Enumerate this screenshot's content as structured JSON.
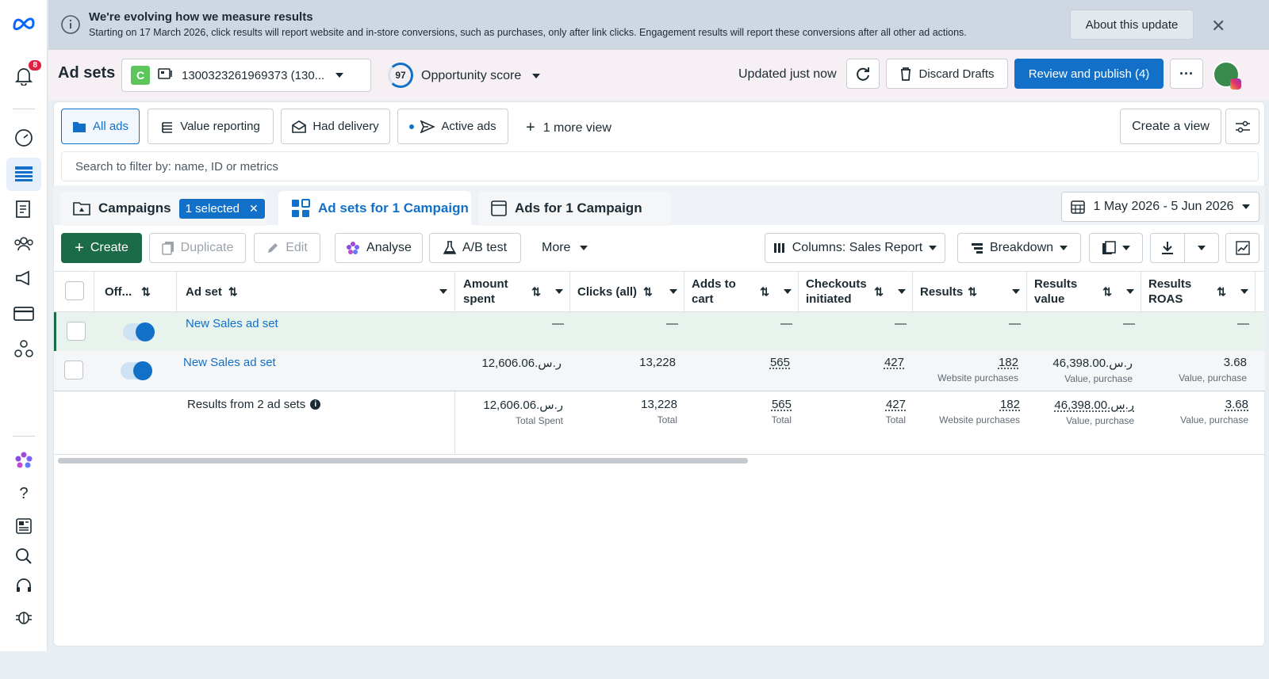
{
  "banner": {
    "title": "We're evolving how we measure results",
    "subtitle": "Starting on 17 March 2026, click results will report website and in-store conversions, such as purchases, only after link clicks. Engagement results will report these conversions after all other ad actions.",
    "about_button": "About this update"
  },
  "rail": {
    "notification_count": "8"
  },
  "header": {
    "page_title": "Ad sets",
    "account_letter": "C",
    "account_name": "1300323261969373 (130...",
    "opportunity_score_value": "97",
    "opportunity_score_label": "Opportunity score",
    "updated_text": "Updated just now",
    "discard_label": "Discard Drafts",
    "publish_label": "Review and publish (4)"
  },
  "views": {
    "all_ads": "All ads",
    "value_reporting": "Value reporting",
    "had_delivery": "Had delivery",
    "active_ads": "Active ads",
    "more_view": "1 more view",
    "create_view": "Create a view"
  },
  "search": {
    "placeholder": "Search to filter by: name, ID or metrics"
  },
  "tabs": {
    "campaigns": "Campaigns",
    "selected": "1 selected",
    "adsets": "Ad sets for 1 Campaign",
    "ads": "Ads for 1 Campaign",
    "date_range": "1 May 2026 - 5 Jun 2026"
  },
  "actions": {
    "create": "Create",
    "duplicate": "Duplicate",
    "edit": "Edit",
    "analyse": "Analyse",
    "ab_test": "A/B test",
    "more": "More",
    "columns": "Columns: Sales Report",
    "breakdown": "Breakdown"
  },
  "table": {
    "columns": {
      "off": "Off...",
      "adset": "Ad set",
      "amount_spent_1": "Amount",
      "amount_spent_2": "spent",
      "clicks": "Clicks (all)",
      "adds_to_cart_1": "Adds to",
      "adds_to_cart_2": "cart",
      "checkouts_1": "Checkouts",
      "checkouts_2": "initiated",
      "results": "Results",
      "results_value_1": "Results",
      "results_value_2": "value",
      "results_roas_1": "Results",
      "results_roas_2": "ROAS"
    },
    "rows": [
      {
        "name": "New Sales ad set",
        "amount": "—",
        "clicks": "—",
        "adds": "—",
        "checkouts": "—",
        "results": "—",
        "results_sub": "",
        "value": "—",
        "value_sub": "",
        "roas": "—",
        "roas_sub": ""
      },
      {
        "name": "New Sales ad set",
        "amount": "12,606.06.ر.س",
        "clicks": "13,228",
        "adds": "565",
        "checkouts": "427",
        "results": "182",
        "results_sub": "Website purchases",
        "value": "46,398.00.ر.س",
        "value_sub": "Value, purchase",
        "roas": "3.68",
        "roas_sub": "Value, purchase"
      }
    ],
    "summary": {
      "label": "Results from 2 ad sets",
      "amount": "12,606.06.ر.س",
      "amount_sub": "Total Spent",
      "clicks": "13,228",
      "clicks_sub": "Total",
      "adds": "565",
      "adds_sub": "Total",
      "checkouts": "427",
      "checkouts_sub": "Total",
      "results": "182",
      "results_sub": "Website purchases",
      "value": "46,398.00.ر.س",
      "value_sub": "Value, purchase",
      "roas": "3.68",
      "roas_sub": "Value, purchase"
    }
  },
  "colors": {
    "primary": "#1270c9",
    "create_green": "#1c6b48",
    "notification_red": "#e41e3f"
  }
}
